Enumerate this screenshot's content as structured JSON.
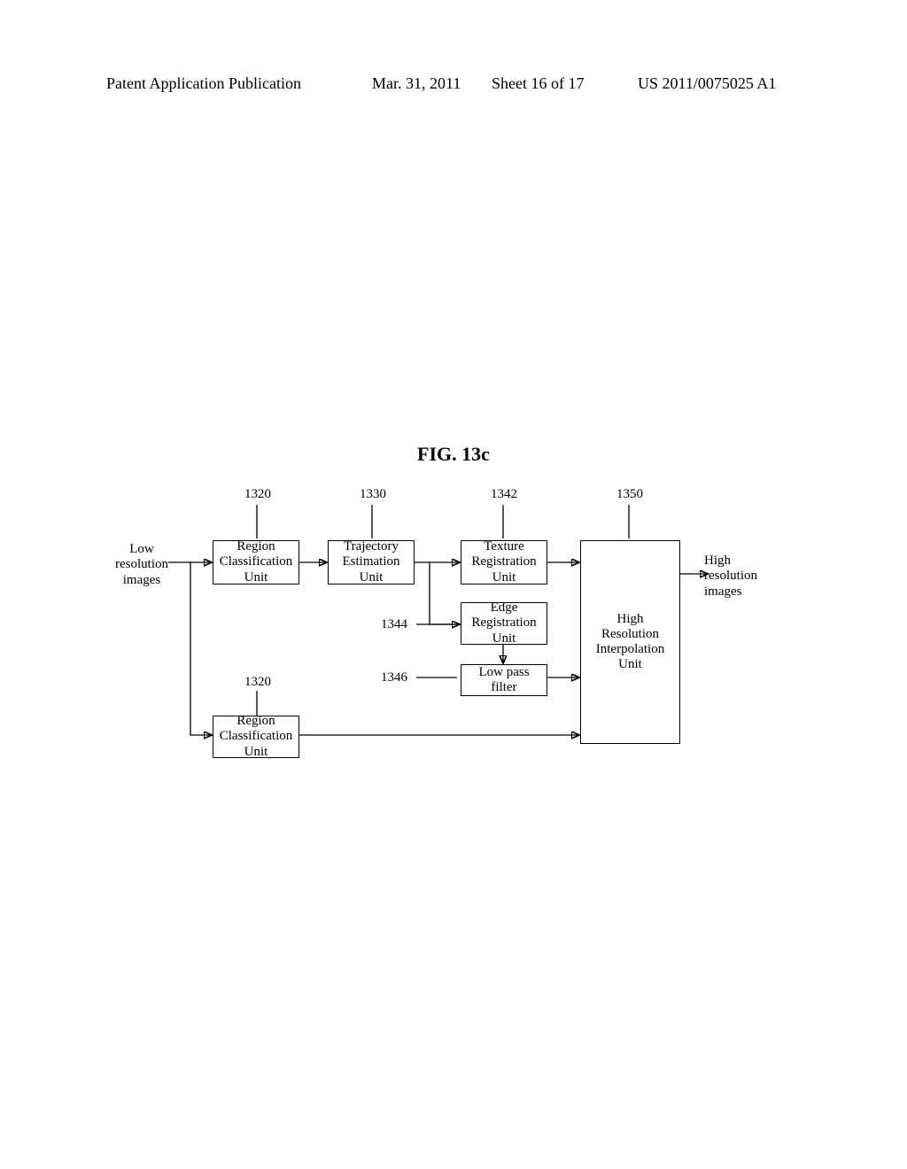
{
  "header": {
    "left": "Patent Application Publication",
    "date": "Mar. 31, 2011",
    "sheet": "Sheet 16 of 17",
    "pubnum": "US 2011/0075025 A1"
  },
  "figure_title": "FIG. 13c",
  "labels": {
    "input": "Low\nresolution\nimages",
    "output": "High\nresolution\nimages"
  },
  "boxes": {
    "region1": "Region\nClassification\nUnit",
    "trajectory": "Trajectory\nEstimation\nUnit",
    "texture": "Texture\nRegistration\nUnit",
    "edge": "Edge\nRegistration\nUnit",
    "lowpass": "Low pass\nfilter",
    "hires": "High\nResolution\nInterpolation\nUnit",
    "region2": "Region\nClassification\nUnit"
  },
  "refs": {
    "r1320a": "1320",
    "r1330": "1330",
    "r1342": "1342",
    "r1350": "1350",
    "r1344": "1344",
    "r1346": "1346",
    "r1320b": "1320"
  }
}
